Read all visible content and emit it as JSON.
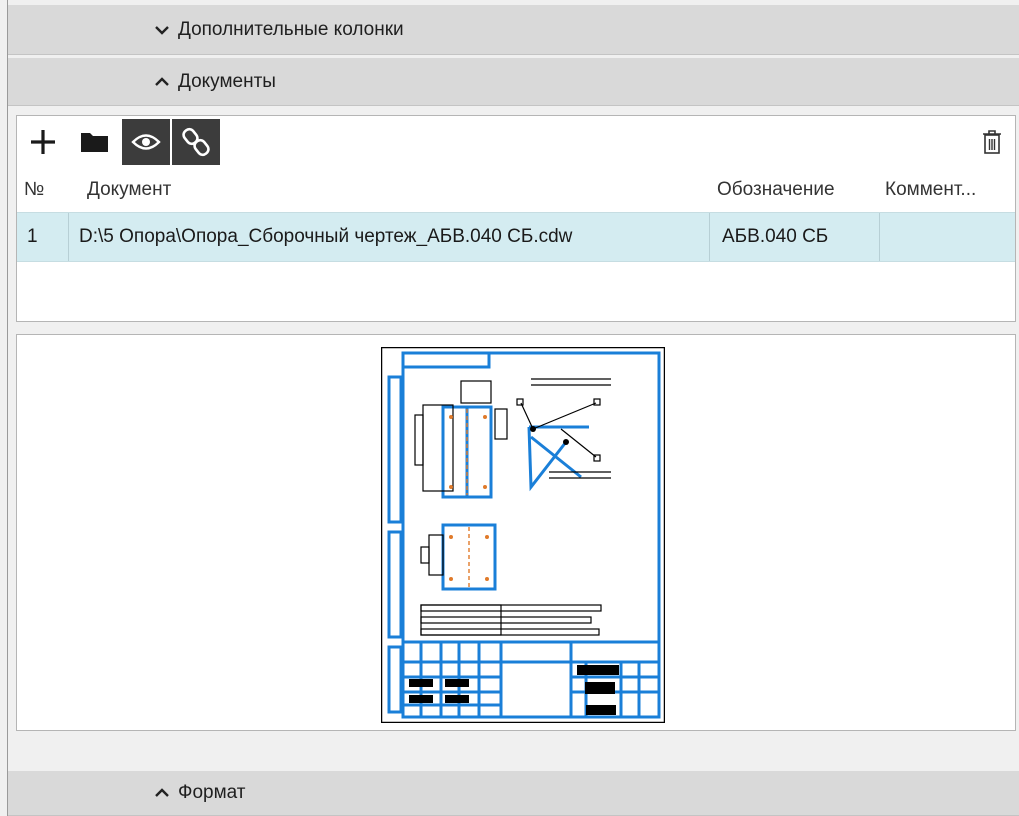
{
  "sections": {
    "extra_columns": "Дополнительные колонки",
    "documents": "Документы",
    "format": "Формат"
  },
  "columns": {
    "number": "№",
    "document": "Документ",
    "designation": "Обозначение",
    "comment": "Коммент..."
  },
  "rows": [
    {
      "number": "1",
      "document": "D:\\5 Опора\\Опора_Сборочный чертеж_АБВ.040 СБ.cdw",
      "designation": "АБВ.040 СБ",
      "comment": ""
    }
  ],
  "colors": {
    "drawing_line": "#1a7fd8",
    "row_selected": "#d4ecf1",
    "header_bg": "#d9d9d9"
  },
  "icons": {
    "add": "plus-icon",
    "open": "folder-icon",
    "view": "eye-icon",
    "link": "chain-link-icon",
    "delete": "trash-icon",
    "expand": "chevron-down-icon",
    "collapse": "chevron-up-icon"
  }
}
